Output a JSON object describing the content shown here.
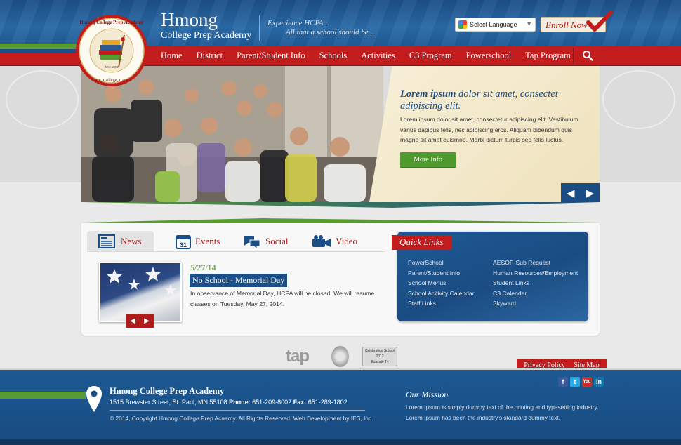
{
  "header": {
    "title": "Hmong",
    "subtitle": "College Prep Academy",
    "tagline_1": "Experience HCPA...",
    "tagline_2": "All that a school should be...",
    "language_label": "Select Language",
    "enroll_label": "Enroll Now",
    "seal": {
      "name": "Hmong College Prep Academy",
      "est": "EST. 2004",
      "motto": "Core, College, Career"
    }
  },
  "nav": {
    "items": [
      "Home",
      "District",
      "Parent/Student Info",
      "Schools",
      "Activities",
      "C3 Program",
      "Powerschool",
      "Tap Program"
    ]
  },
  "hero": {
    "heading_strong": "Lorem ipsum",
    "heading_rest": " dolor sit amet, consectet adipiscing elit.",
    "body": "Lorem ipsum dolor sit amet, consectetur adipiscing elit. Vestibulum varius dapibus felis, nec adipiscing eros. Aliquam bibendum quis magna sit amet euismod. Morbi dictum turpis sed felis luctus.",
    "button": "More Info"
  },
  "tabs": {
    "news": "News",
    "events": "Events",
    "events_day": "31",
    "social": "Social",
    "video": "Video"
  },
  "news": {
    "date": "5/27/14",
    "title": "No School - Memorial Day",
    "body": "In observance of Memorial Day, HCPA will be closed.  We will resume classes on Tuesday, May 27, 2014."
  },
  "quick_links": {
    "title": "Quick Links",
    "left": [
      "PowerSchool",
      "Parent/Student Info",
      "School Menus",
      "School Acitivity Calendar",
      "Staff Links"
    ],
    "right": [
      "AESOP-Sub Request",
      "Human Resources/Employment",
      "Student Links",
      "C3 Calendar",
      "Skyward"
    ]
  },
  "badges": {
    "tap": "tap",
    "celebration": "Celebration School 2012",
    "educate": "Educate Tv"
  },
  "footer": {
    "privacy": "Privacy Policy",
    "sitemap": "Site Map",
    "name": "Hmong College Prep Academy",
    "address": "1515 Brewster Street, St. Paul, MN 55108",
    "phone_label": "Phone:",
    "phone": "651-209-8002",
    "fax_label": "Fax:",
    "fax": "651-289-1802",
    "copyright": "© 2014, Copyright Hmong College Prep Acaemy. All Rights Reserved. Web Development by IES, Inc.",
    "mission_title": "Our Mission",
    "mission_body": "Lorem Ipsum is simply dummy text of the printing and typesetting industry. Lorem Ipsum has been the industry's standard dummy text."
  },
  "colors": {
    "brand_blue": "#1b4f86",
    "brand_red": "#c21c1c",
    "brand_green": "#5a9a34"
  }
}
